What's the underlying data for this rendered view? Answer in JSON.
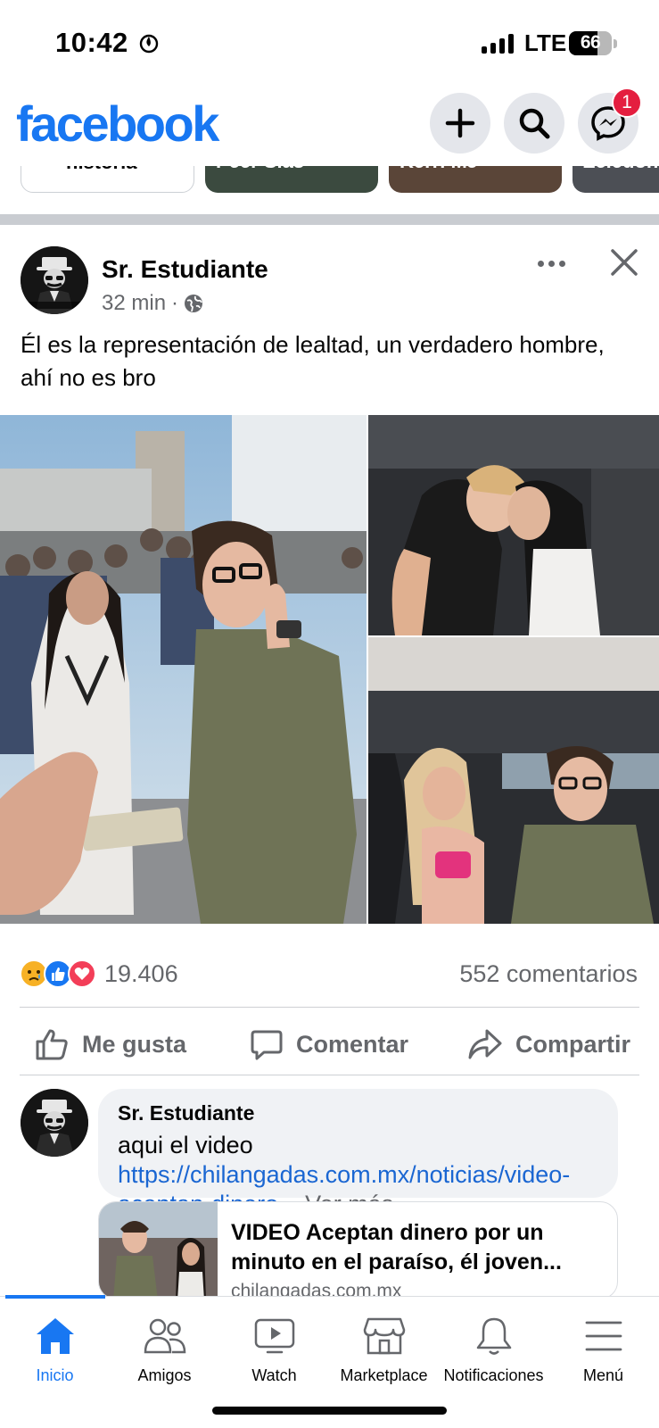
{
  "status_bar": {
    "time": "10:42",
    "network": "LTE",
    "battery": "66",
    "battery_level": 0.66,
    "icons": [
      "focus-flame-icon",
      "signal-icon",
      "battery-icon"
    ]
  },
  "header": {
    "logo": "facebook",
    "brand_color": "#1877f2",
    "buttons": [
      "plus-icon",
      "search-icon",
      "messenger-icon"
    ],
    "messenger_badge": "1"
  },
  "stories": {
    "items": [
      {
        "label": "historia"
      },
      {
        "label": "Peer Sias"
      },
      {
        "label": "Kerri MJ"
      },
      {
        "label": "Zeledon"
      }
    ]
  },
  "post": {
    "author": "Sr. Estudiante",
    "time": "32 min",
    "separator": "·",
    "privacy_icon": "globe-icon",
    "text": "Él es la representación de lealtad, un verdadero hombre, ahí no es bro",
    "reaction_icons": [
      "sad-icon",
      "like-icon",
      "love-icon"
    ],
    "reaction_count": "19.406",
    "comments_count": "552 comentarios",
    "actions": {
      "like": "Me gusta",
      "comment": "Comentar",
      "share": "Compartir"
    }
  },
  "comment": {
    "author": "Sr. Estudiante",
    "text": "aqui el video ",
    "link": "https://chilangadas.com.mx/noticias/video-aceptan-dinero",
    "ellipsis": "...",
    "see_more": " Ver más",
    "card_title": "VIDEO Aceptan dinero por un minuto en el paraíso, él joven...",
    "card_domain": "chilangadas.com.mx"
  },
  "tabbar": {
    "tabs": [
      {
        "label": "Inicio",
        "icon": "home-icon",
        "active": true
      },
      {
        "label": "Amigos",
        "icon": "friends-icon",
        "active": false
      },
      {
        "label": "Watch",
        "icon": "watch-icon",
        "active": false
      },
      {
        "label": "Marketplace",
        "icon": "marketplace-icon",
        "active": false
      },
      {
        "label": "Notificaciones",
        "icon": "bell-icon",
        "active": false
      },
      {
        "label": "Menú",
        "icon": "menu-icon",
        "active": false
      }
    ]
  }
}
